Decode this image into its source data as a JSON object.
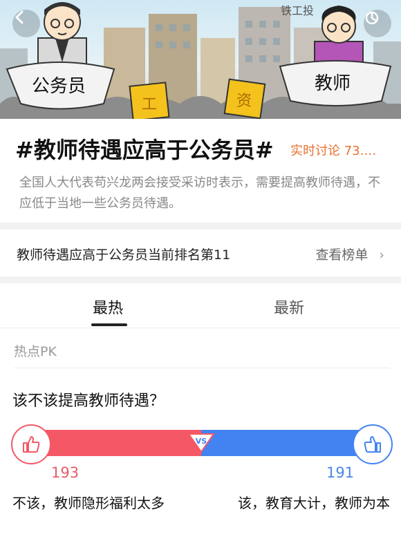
{
  "banner": {
    "sign_left": "公务员",
    "sign_right": "教师",
    "wage_char_1": "工",
    "wage_char_2": "资",
    "building_sign": "铁工投"
  },
  "topic": {
    "title": "#教师待遇应高于公务员#",
    "live_count": "实时讨论 73.…",
    "description": "全国人大代表苟兴龙两会接受采访时表示，需要提高教师待遇，不应低于当地一些公务员待遇。"
  },
  "rank": {
    "text": "教师待遇应高于公务员当前排名第11",
    "link_label": "查看榜单"
  },
  "tabs": [
    {
      "label": "最热",
      "active": true
    },
    {
      "label": "最新",
      "active": false
    }
  ],
  "pk": {
    "section_label": "热点PK",
    "question": "该不该提高教师待遇？",
    "vs_label": "VS",
    "left": {
      "count": "193",
      "option": "不该，教师隐形福利太多",
      "color": "#f45866"
    },
    "right": {
      "count": "191",
      "option": "该，教育大计，教师为本",
      "color": "#4383f1"
    },
    "left_share": 0.5026
  },
  "icons": [
    "back-arrow-icon",
    "share-icon",
    "thumbs-up-icon",
    "chevron-right-icon",
    "vs-icon"
  ]
}
